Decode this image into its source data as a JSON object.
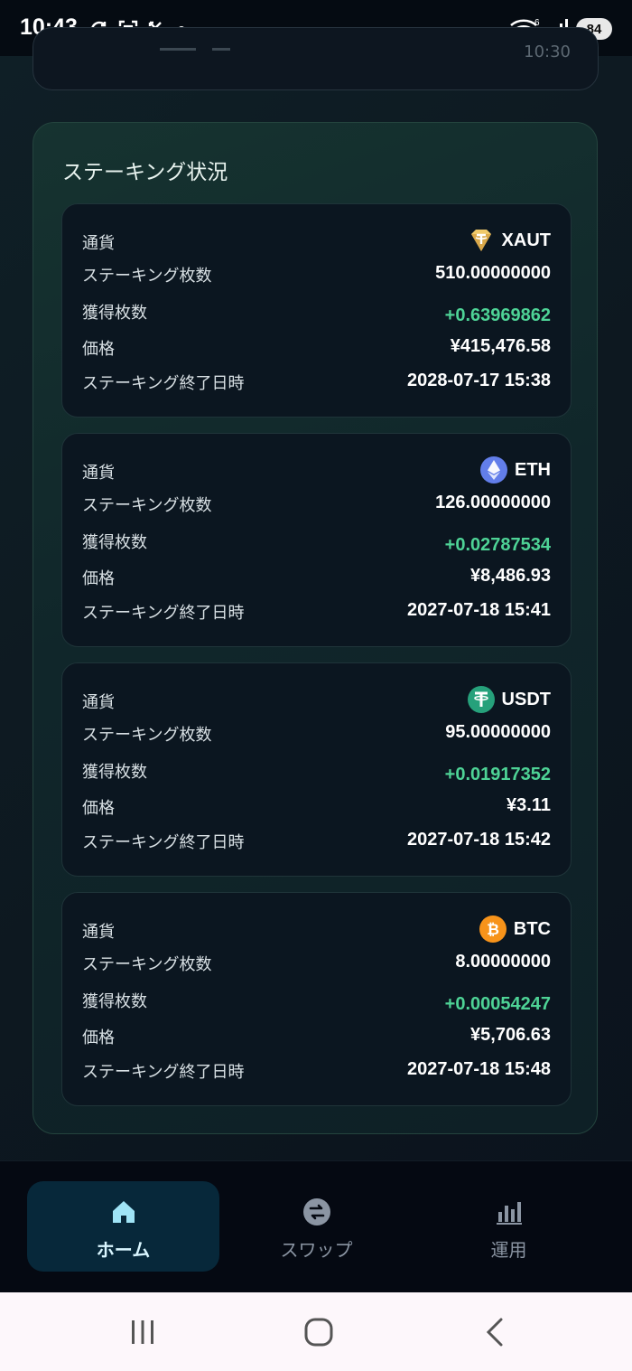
{
  "status_bar": {
    "time": "10:43",
    "battery": "84",
    "wifi_badge": "6"
  },
  "top_card": {
    "partial_value": "10:30"
  },
  "staking": {
    "title": "ステーキング状況",
    "labels": {
      "currency": "通貨",
      "amount": "ステーキング枚数",
      "earned": "獲得枚数",
      "price": "価格",
      "end_date": "ステーキング終了日時"
    },
    "items": [
      {
        "coin": "XAUT",
        "icon": "xaut-icon",
        "amount": "510.00000000",
        "earned": "+0.63969862",
        "price": "¥415,476.58",
        "end_date": "2028-07-17 15:38"
      },
      {
        "coin": "ETH",
        "icon": "eth-icon",
        "amount": "126.00000000",
        "earned": "+0.02787534",
        "price": "¥8,486.93",
        "end_date": "2027-07-18 15:41"
      },
      {
        "coin": "USDT",
        "icon": "usdt-icon",
        "amount": "95.00000000",
        "earned": "+0.01917352",
        "price": "¥3.11",
        "end_date": "2027-07-18 15:42"
      },
      {
        "coin": "BTC",
        "icon": "btc-icon",
        "amount": "8.00000000",
        "earned": "+0.00054247",
        "price": "¥5,706.63",
        "end_date": "2027-07-18 15:48"
      }
    ]
  },
  "bottom_nav": {
    "items": [
      {
        "label": "ホーム",
        "icon": "home-icon",
        "active": true
      },
      {
        "label": "スワップ",
        "icon": "swap-icon",
        "active": false
      },
      {
        "label": "運用",
        "icon": "chart-bars-icon",
        "active": false
      }
    ]
  },
  "colors": {
    "accent_green": "#4ed396",
    "active_nav": "#07283a",
    "section_border": "#24443e"
  }
}
